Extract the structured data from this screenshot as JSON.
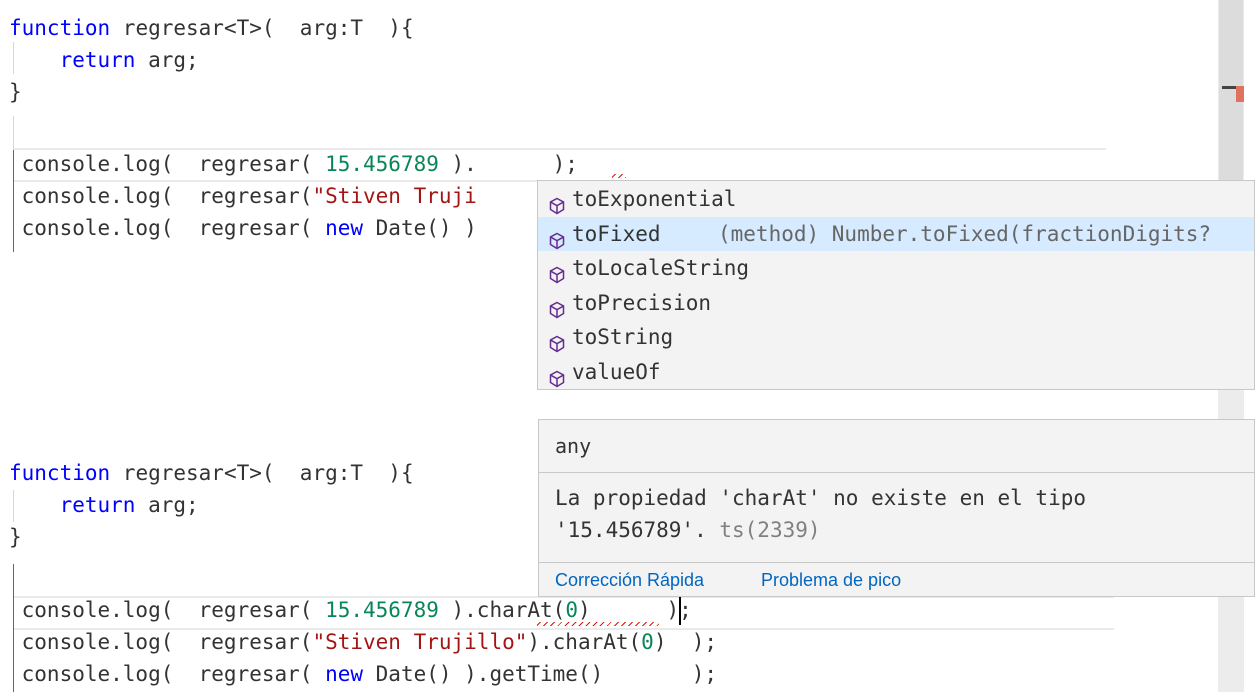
{
  "editor_top": {
    "lines": [
      {
        "parts": [
          [
            "kw",
            "function"
          ],
          [
            "ident",
            " regresar<T>(  arg:T  ){"
          ]
        ]
      },
      {
        "parts": [
          [
            "kw",
            "    return"
          ],
          [
            "ident",
            " arg;"
          ]
        ]
      },
      {
        "parts": [
          [
            "ident",
            "}"
          ]
        ]
      },
      {
        "parts": [
          [
            "ident",
            " console.log(  regresar( "
          ],
          [
            "num",
            "15.456789"
          ],
          [
            "ident",
            " ).      );"
          ]
        ]
      },
      {
        "parts": [
          [
            "ident",
            " console.log(  regresar("
          ],
          [
            "str",
            "\"Stiven Truji"
          ]
        ]
      },
      {
        "parts": [
          [
            "ident",
            " console.log(  regresar( "
          ],
          [
            "kw",
            "new"
          ],
          [
            "ident",
            " Date() )"
          ]
        ]
      }
    ]
  },
  "suggest": {
    "items": [
      {
        "label": "toExponential",
        "detail": ""
      },
      {
        "label": "toFixed",
        "detail": "(method) Number.toFixed(fractionDigits?"
      },
      {
        "label": "toLocaleString",
        "detail": ""
      },
      {
        "label": "toPrecision",
        "detail": ""
      },
      {
        "label": "toString",
        "detail": ""
      },
      {
        "label": "valueOf",
        "detail": ""
      }
    ],
    "selected_index": 1,
    "icon": "method-cube-icon"
  },
  "editor_bottom": {
    "lines": [
      {
        "parts": [
          [
            "kw",
            "function"
          ],
          [
            "ident",
            " regresar<T>(  arg:T  ){"
          ]
        ]
      },
      {
        "parts": [
          [
            "kw",
            "    return"
          ],
          [
            "ident",
            " arg;"
          ]
        ]
      },
      {
        "parts": [
          [
            "ident",
            "}"
          ]
        ]
      },
      {
        "parts": [
          [
            "ident",
            " console.log(  regresar( "
          ],
          [
            "num",
            "15.456789"
          ],
          [
            "ident",
            " ).charAt("
          ],
          [
            "num",
            "0"
          ],
          [
            "ident",
            ")      );"
          ]
        ]
      },
      {
        "parts": [
          [
            "ident",
            " console.log(  regresar("
          ],
          [
            "str",
            "\"Stiven Trujillo\""
          ],
          [
            "ident",
            ").charAt("
          ],
          [
            "num",
            "0"
          ],
          [
            "ident",
            ")  );"
          ]
        ]
      },
      {
        "parts": [
          [
            "ident",
            " console.log(  regresar( "
          ],
          [
            "kw",
            "new"
          ],
          [
            "ident",
            " Date() ).getTime()       );"
          ]
        ]
      }
    ]
  },
  "hover": {
    "type": "any",
    "message_line1": "La propiedad 'charAt' no existe en el tipo",
    "message_line2": "'15.456789'. ",
    "code": "ts(2339)",
    "action_quick_fix": "Corrección Rápida",
    "action_peek": "Problema de pico"
  },
  "colors": {
    "keyword": "#0000ff",
    "string": "#a31515",
    "number": "#098658",
    "selection": "#d6ebff",
    "link": "#0066bf",
    "error": "#e51400"
  }
}
